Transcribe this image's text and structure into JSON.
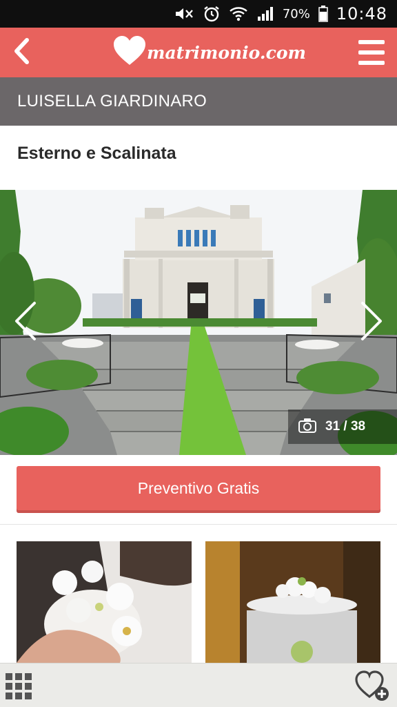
{
  "status_bar": {
    "battery": "70%",
    "time": "10:48",
    "icons": [
      "mute-icon",
      "alarm-icon",
      "wifi-icon",
      "signal-icon",
      "battery-icon"
    ]
  },
  "header": {
    "logo_text": "matrimonio.com",
    "icons": [
      "back-icon",
      "heart-logo-icon",
      "hamburger-menu-icon"
    ],
    "brand_color": "#e8625d"
  },
  "vendor": {
    "name": "LUISELLA GIARDINARO"
  },
  "gallery": {
    "title": "Esterno e Scalinata",
    "counter": "31 / 38",
    "current": 31,
    "total": 38,
    "icons": [
      "chevron-left-icon",
      "chevron-right-icon",
      "camera-icon"
    ]
  },
  "cta": {
    "label": "Preventivo Gratis"
  },
  "bottom_bar": {
    "icons": [
      "grid-icon",
      "heart-plus-icon"
    ]
  }
}
